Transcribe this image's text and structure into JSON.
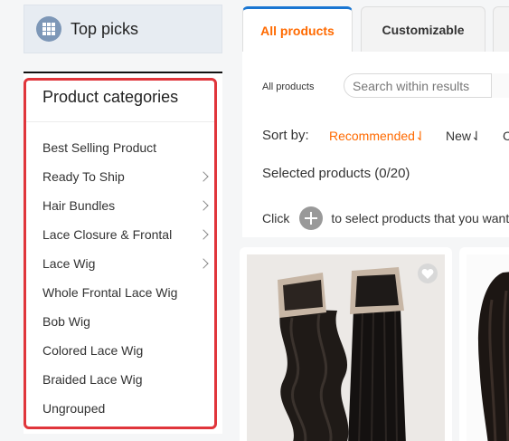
{
  "sidebar": {
    "top_picks": "Top picks",
    "categories_title": "Product categories",
    "categories": [
      {
        "label": "Best Selling Product",
        "has_children": false
      },
      {
        "label": "Ready To Ship",
        "has_children": true
      },
      {
        "label": "Hair Bundles",
        "has_children": true
      },
      {
        "label": "Lace Closure & Frontal",
        "has_children": true
      },
      {
        "label": "Lace Wig",
        "has_children": true
      },
      {
        "label": "Whole Frontal Lace Wig",
        "has_children": false
      },
      {
        "label": "Bob Wig",
        "has_children": false
      },
      {
        "label": "Colored Lace Wig",
        "has_children": false
      },
      {
        "label": "Braided Lace Wig",
        "has_children": false
      },
      {
        "label": "Ungrouped",
        "has_children": false
      }
    ]
  },
  "tabs": [
    {
      "label": "All products",
      "active": true
    },
    {
      "label": "Customizable",
      "active": false
    },
    {
      "label": "",
      "active": false
    }
  ],
  "toolbar": {
    "breadcrumb": "All products",
    "search_placeholder": "Search within results",
    "sort_label": "Sort by:",
    "sort_recommended": "Recommended⇃",
    "sort_new": "New⇃",
    "sort_more": "C",
    "selected_text": "Selected products (0/20)",
    "click_prefix": "Click",
    "click_suffix": "to select products that you want t"
  },
  "colors": {
    "accent_orange": "#ff6a00",
    "tab_blue": "#1976d2",
    "highlight_red": "#e0353b",
    "top_picks_bg": "#e7ecf2"
  },
  "icons": {
    "top_picks": "grid-icon",
    "category_chevron": "chevron-right-icon",
    "select_plus": "plus-circle-icon",
    "favorite": "heart-icon"
  }
}
